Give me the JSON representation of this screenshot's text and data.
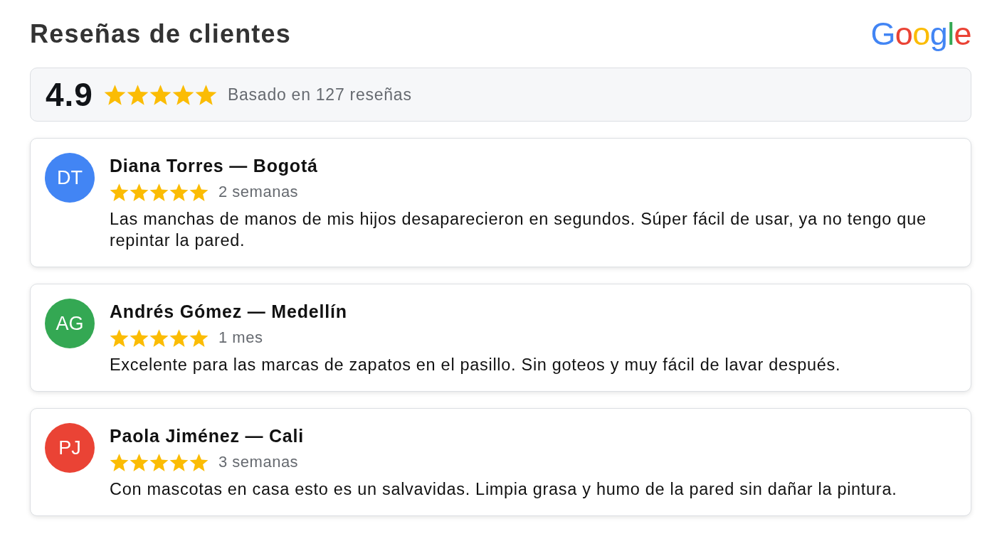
{
  "header": {
    "title": "Reseñas de clientes",
    "logo": "Google"
  },
  "summary": {
    "rating": "4.9",
    "stars": 5,
    "caption": "Basado en 127 reseñas"
  },
  "reviews": [
    {
      "initials": "DT",
      "color": "#4285f4",
      "author": "Diana Torres — Bogotá",
      "stars": 5,
      "time": "2 semanas",
      "text": "Las manchas de manos de mis hijos desaparecieron en segundos. Súper fácil de usar, ya no tengo que repintar la pared."
    },
    {
      "initials": "AG",
      "color": "#34a853",
      "author": "Andrés Gómez — Medellín",
      "stars": 5,
      "time": "1 mes",
      "text": "Excelente para las marcas de zapatos en el pasillo. Sin goteos y muy fácil de lavar después."
    },
    {
      "initials": "PJ",
      "color": "#ea4335",
      "author": "Paola Jiménez — Cali",
      "stars": 5,
      "time": "3 semanas",
      "text": "Con mascotas en casa esto es un salvavidas. Limpia grasa y humo de la pared sin dañar la pintura."
    }
  ]
}
